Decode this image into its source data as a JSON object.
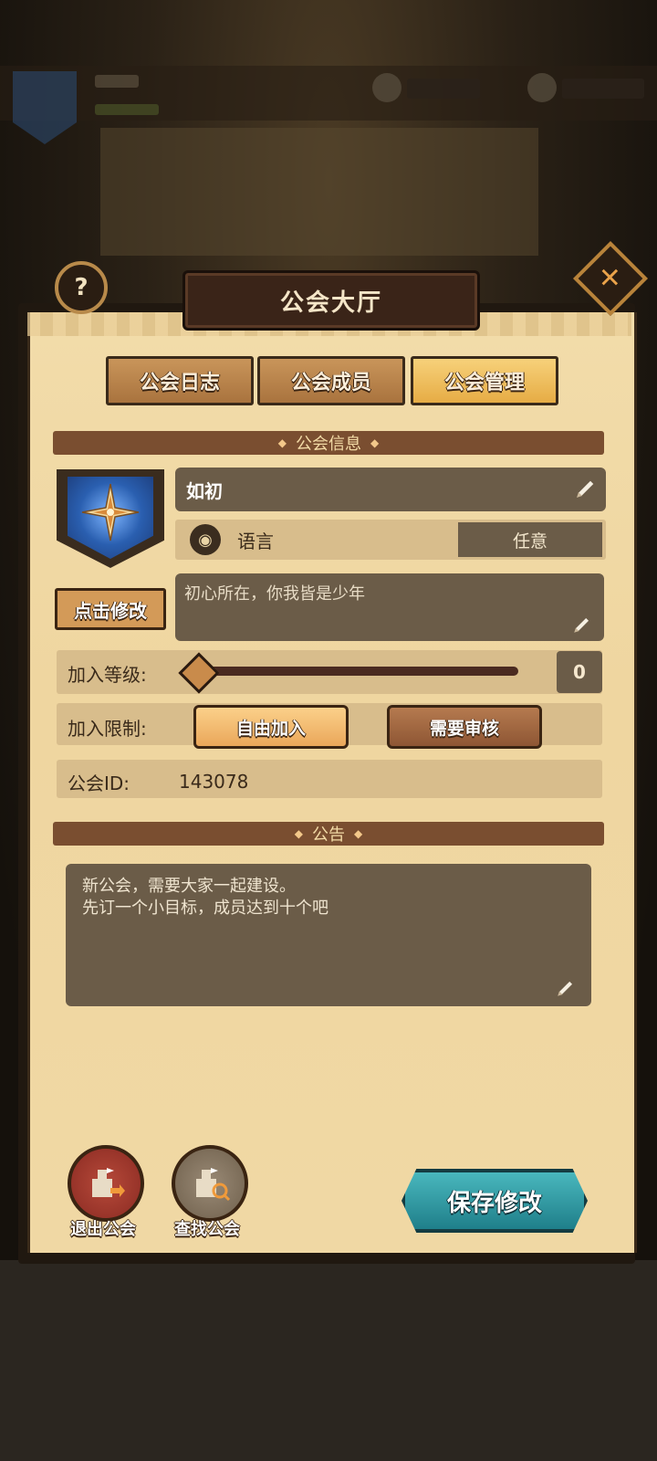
{
  "dialog": {
    "title": "公会大厅"
  },
  "tabs": [
    {
      "label": "公会日志",
      "active": false
    },
    {
      "label": "公会成员",
      "active": false
    },
    {
      "label": "公会管理",
      "active": true
    }
  ],
  "guild_info": {
    "section_title": "公会信息",
    "emblem_button": "点击修改",
    "name": "如初",
    "language_label": "语言",
    "language_value": "任意",
    "motto": "初心所在，你我皆是少年",
    "join_level_label": "加入等级:",
    "join_level_value": "0",
    "join_restriction_label": "加入限制:",
    "join_options": [
      "自由加入",
      "需要审核"
    ],
    "join_selected": "自由加入",
    "id_label": "公会ID:",
    "id_value": "143078"
  },
  "notice": {
    "section_title": "公告",
    "line1": "新公会，需要大家一起建设。",
    "line2": "先订一个小目标，成员达到十个吧"
  },
  "actions": {
    "exit_label": "退出公会",
    "find_label": "查找公会",
    "save_label": "保存修改"
  },
  "icons": {
    "help": "?",
    "close": "✕",
    "globe": "◉"
  },
  "colors": {
    "accent_gold": "#e6ac45",
    "save_teal": "#1f7f8a",
    "exit_red": "#8a2a22"
  }
}
